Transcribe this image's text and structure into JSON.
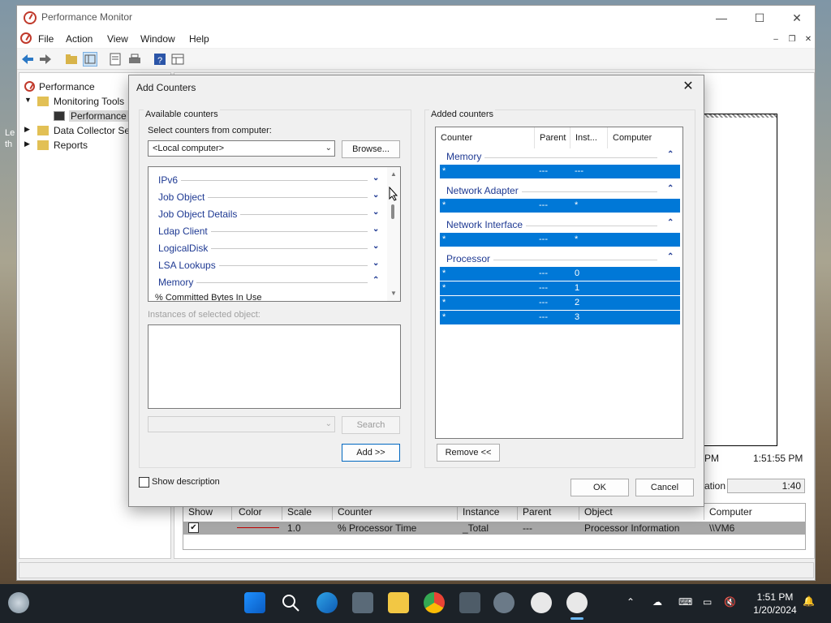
{
  "window": {
    "title": "Performance Monitor"
  },
  "menu": [
    "File",
    "Action",
    "View",
    "Window",
    "Help"
  ],
  "tree": [
    {
      "label": "Performance"
    },
    {
      "label": "Monitoring Tools"
    },
    {
      "label": "Performance M"
    },
    {
      "label": "Data Collector Set"
    },
    {
      "label": "Reports"
    }
  ],
  "graph": {
    "time_left": "PM",
    "time_right": "1:51:55 PM",
    "duration_label": "ation",
    "duration_value": "1:40"
  },
  "counter_table": {
    "headers": [
      "Show",
      "Color",
      "Scale",
      "Counter",
      "Instance",
      "Parent",
      "Object",
      "Computer"
    ],
    "row": {
      "show": "✔",
      "scale": "1.0",
      "counter": "% Processor Time",
      "instance": "_Total",
      "parent": "---",
      "object": "Processor Information",
      "computer": "\\\\VM6"
    },
    "line_color": "#c00000"
  },
  "dialog": {
    "title": "Add Counters",
    "available_label": "Available counters",
    "select_label": "Select counters from computer:",
    "computer_value": "<Local computer>",
    "browse_label": "Browse...",
    "objects": [
      {
        "label": "IPv6",
        "chev": "⌄"
      },
      {
        "label": "Job Object",
        "chev": "⌄"
      },
      {
        "label": "Job Object Details",
        "chev": "⌄"
      },
      {
        "label": "Ldap Client",
        "chev": "⌄"
      },
      {
        "label": "LogicalDisk",
        "chev": "⌄"
      },
      {
        "label": "LSA Lookups",
        "chev": "⌄"
      },
      {
        "label": "Memory",
        "chev": "⌃"
      }
    ],
    "partial_item": "% Committed Bytes In Use",
    "instances_label": "Instances of selected object:",
    "search_label": "Search",
    "add_label": "Add >>",
    "show_description_label": "Show description",
    "added_label": "Added counters",
    "added_headers": [
      "Counter",
      "Parent",
      "Inst...",
      "Computer"
    ],
    "added_groups": [
      {
        "name": "Memory",
        "rows": [
          {
            "counter": "*",
            "parent": "---",
            "instance": "---"
          }
        ]
      },
      {
        "name": "Network Adapter",
        "rows": [
          {
            "counter": "*",
            "parent": "---",
            "instance": "*"
          }
        ]
      },
      {
        "name": "Network Interface",
        "rows": [
          {
            "counter": "*",
            "parent": "---",
            "instance": "*"
          }
        ]
      },
      {
        "name": "Processor",
        "rows": [
          {
            "counter": "*",
            "parent": "---",
            "instance": "0"
          },
          {
            "counter": "*",
            "parent": "---",
            "instance": "1"
          },
          {
            "counter": "*",
            "parent": "---",
            "instance": "2"
          },
          {
            "counter": "*",
            "parent": "---",
            "instance": "3"
          }
        ]
      }
    ],
    "remove_label": "Remove <<",
    "ok_label": "OK",
    "cancel_label": "Cancel"
  },
  "desktop_edge_text": [
    "Le",
    "th"
  ],
  "clock": {
    "time": "1:51 PM",
    "date": "1/20/2024"
  },
  "colors": {
    "accent": "#0078d7",
    "link_blue": "#1f3a93"
  }
}
